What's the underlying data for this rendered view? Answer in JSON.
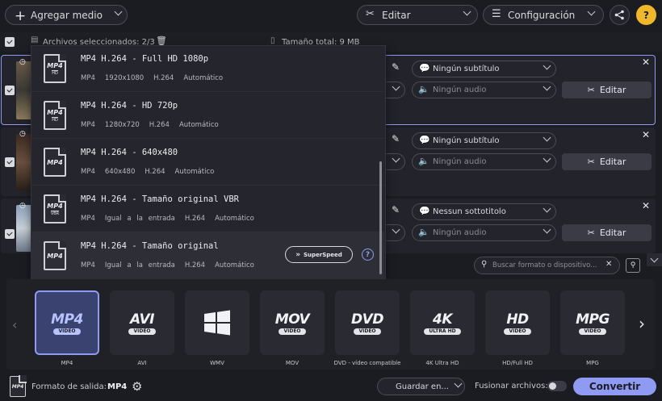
{
  "toolbar": {
    "add_media_label": "Agregar medio",
    "edit_label": "Editar",
    "settings_label": "Configuración",
    "help_label": "?"
  },
  "list_header": {
    "selected_label": "Archivos seleccionados: 2/3",
    "total_size_label": "Tamaño total: 9 MB"
  },
  "files": [
    {
      "subtitle": "Ningún subtítulo",
      "audio": "Ningún audio",
      "edit_label": "Editar"
    },
    {
      "subtitle": "Ningún subtítulo",
      "audio": "Ningún audio",
      "edit_label": "Editar"
    },
    {
      "subtitle": "Nessun sottotitolo",
      "audio": "Ningún audio",
      "edit_label": "Editar"
    }
  ],
  "presets": [
    {
      "icon_text": "MP4",
      "icon_sub": "HD",
      "name": "MP4 H.264 - Full HD 1080p",
      "container": "MP4",
      "resolution": "1920x1080",
      "codec": "H.264",
      "bitrate": "Automático"
    },
    {
      "icon_text": "MP4",
      "icon_sub": "HD",
      "name": "MP4 H.264 - HD 720p",
      "container": "MP4",
      "resolution": "1280x720",
      "codec": "H.264",
      "bitrate": "Automático"
    },
    {
      "icon_text": "MP4",
      "icon_sub": "",
      "name": "MP4 H.264 - 640x480",
      "container": "MP4",
      "resolution": "640x480",
      "codec": "H.264",
      "bitrate": "Automático"
    },
    {
      "icon_text": "MP4",
      "icon_sub": "VBR",
      "name": "MP4 H.264 - Tamaño original VBR",
      "container": "MP4",
      "resolution": "Igual a la entrada",
      "codec": "H.264",
      "bitrate": "Automático"
    },
    {
      "icon_text": "MP4",
      "icon_sub": "",
      "name": "MP4 H.264 - Tamaño original",
      "container": "MP4",
      "resolution": "Igual a la entrada",
      "codec": "H.264",
      "bitrate": "Automático"
    }
  ],
  "superspeed_label": "SuperSpeed",
  "search": {
    "placeholder": "Buscar formato o dispositivo..."
  },
  "formats": [
    {
      "big": "MP4",
      "sub": "VIDEO",
      "label": "MP4"
    },
    {
      "big": "AVI",
      "sub": "VIDEO",
      "label": "AVI"
    },
    {
      "big": "",
      "sub": "",
      "label": "WMV"
    },
    {
      "big": "MOV",
      "sub": "VIDEO",
      "label": "MOV"
    },
    {
      "big": "DVD",
      "sub": "VIDEO",
      "label": "DVD - vídeo compatible"
    },
    {
      "big": "4K",
      "sub": "ULTRA HD",
      "label": "4K Ultra HD"
    },
    {
      "big": "HD",
      "sub": "VIDEO",
      "label": "HD/Full HD"
    },
    {
      "big": "MPG",
      "sub": "VIDEO",
      "label": "MPG"
    }
  ],
  "bottom": {
    "output_format_label": "Formato de salida:",
    "output_format_value": "MP4",
    "save_label": "Guardar en...",
    "merge_label": "Fusionar archivos:",
    "convert_label": "Convertir"
  },
  "colors": {
    "accent": "#8f9bf2",
    "background": "#1b1c22"
  }
}
